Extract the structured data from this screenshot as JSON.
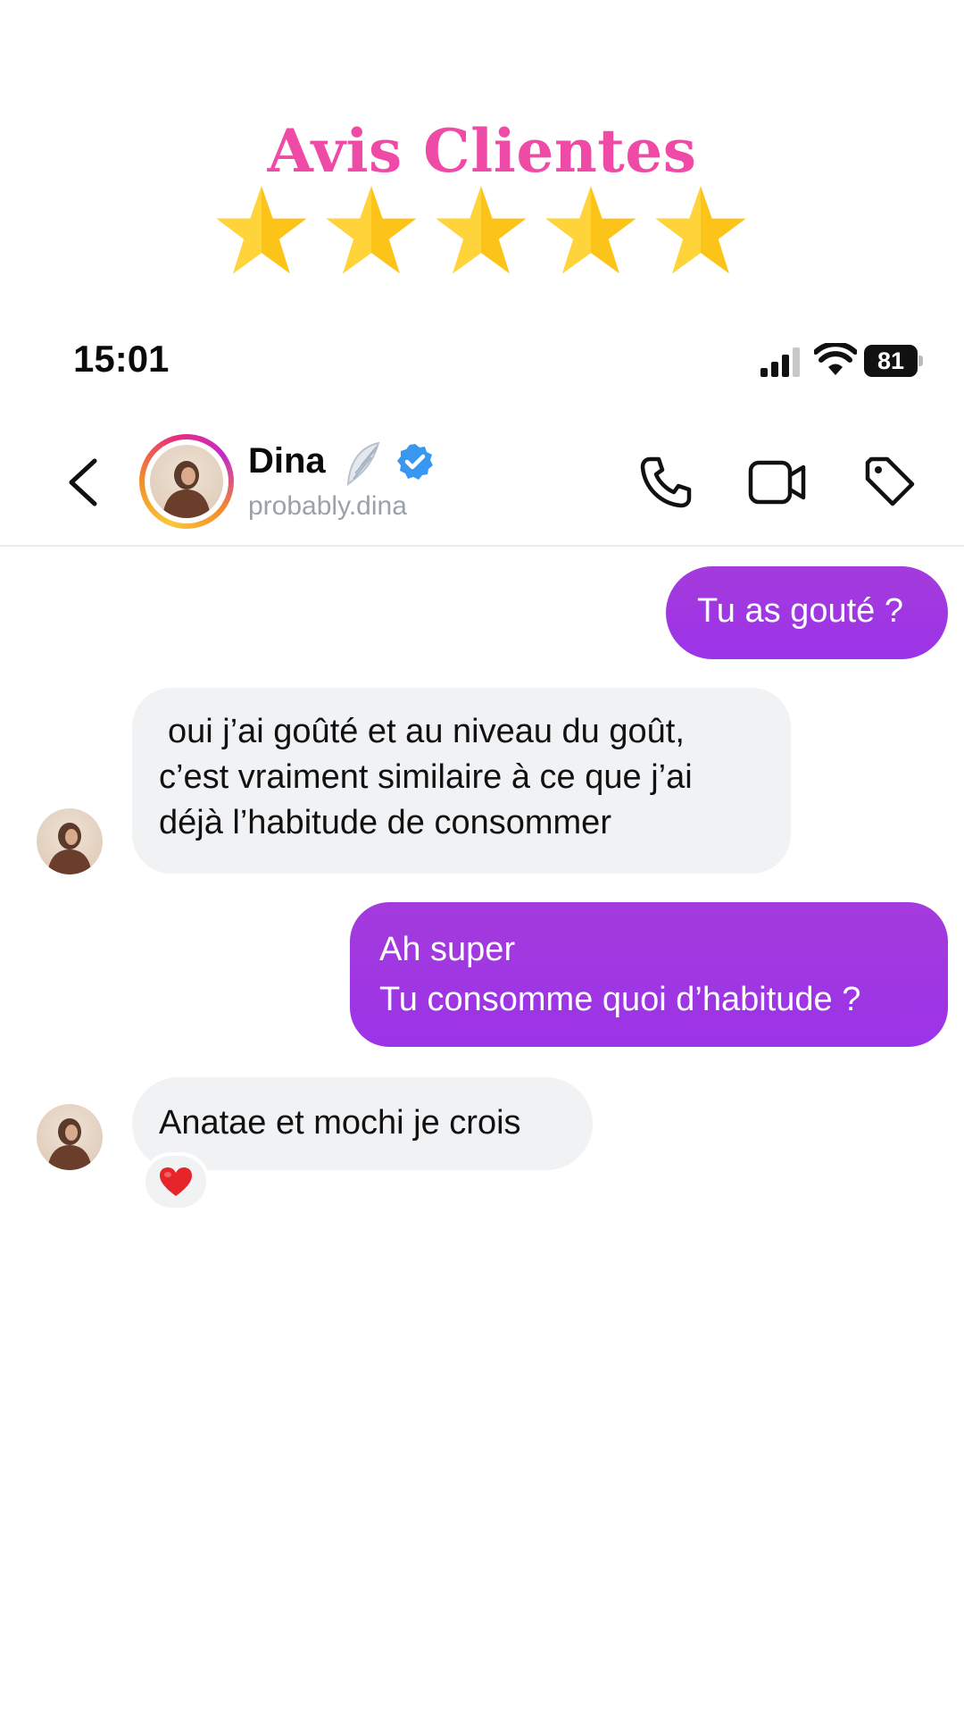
{
  "promo": {
    "title": "Avis Clientes",
    "rating": 5,
    "rating_max": 5,
    "star_color": "#fcc419",
    "title_color": "#ee4aa6"
  },
  "status_bar": {
    "time": "15:01",
    "battery": "81",
    "icons": [
      "cellular-signal-icon",
      "wifi-icon",
      "battery-icon"
    ]
  },
  "chat_header": {
    "back_icon": "chevron-left-icon",
    "name": "Dina",
    "name_icons": [
      "wing-icon",
      "verified-badge-icon"
    ],
    "username": "probably.dina",
    "actions": [
      "phone-icon",
      "video-camera-icon",
      "tag-icon"
    ]
  },
  "messages": [
    {
      "direction": "outgoing",
      "lines": [
        "Tu as gouté ?"
      ]
    },
    {
      "direction": "incoming",
      "lines": [
        "oui j’ai goûté et au niveau du goût,",
        "c’est vraiment similaire à ce que j’ai",
        "déjà l’habitude de consommer"
      ]
    },
    {
      "direction": "outgoing",
      "lines": [
        "Ah super",
        "Tu consomme quoi d’habitude ?"
      ]
    },
    {
      "direction": "incoming",
      "lines": [
        "Anatae et mochi je crois"
      ],
      "reaction": "heart-icon"
    }
  ],
  "colors": {
    "outgoing_bubble": "#9c33e8",
    "incoming_bubble": "#f1f2f4",
    "verified": "#3897f0",
    "reaction_heart": "#e5252a"
  }
}
